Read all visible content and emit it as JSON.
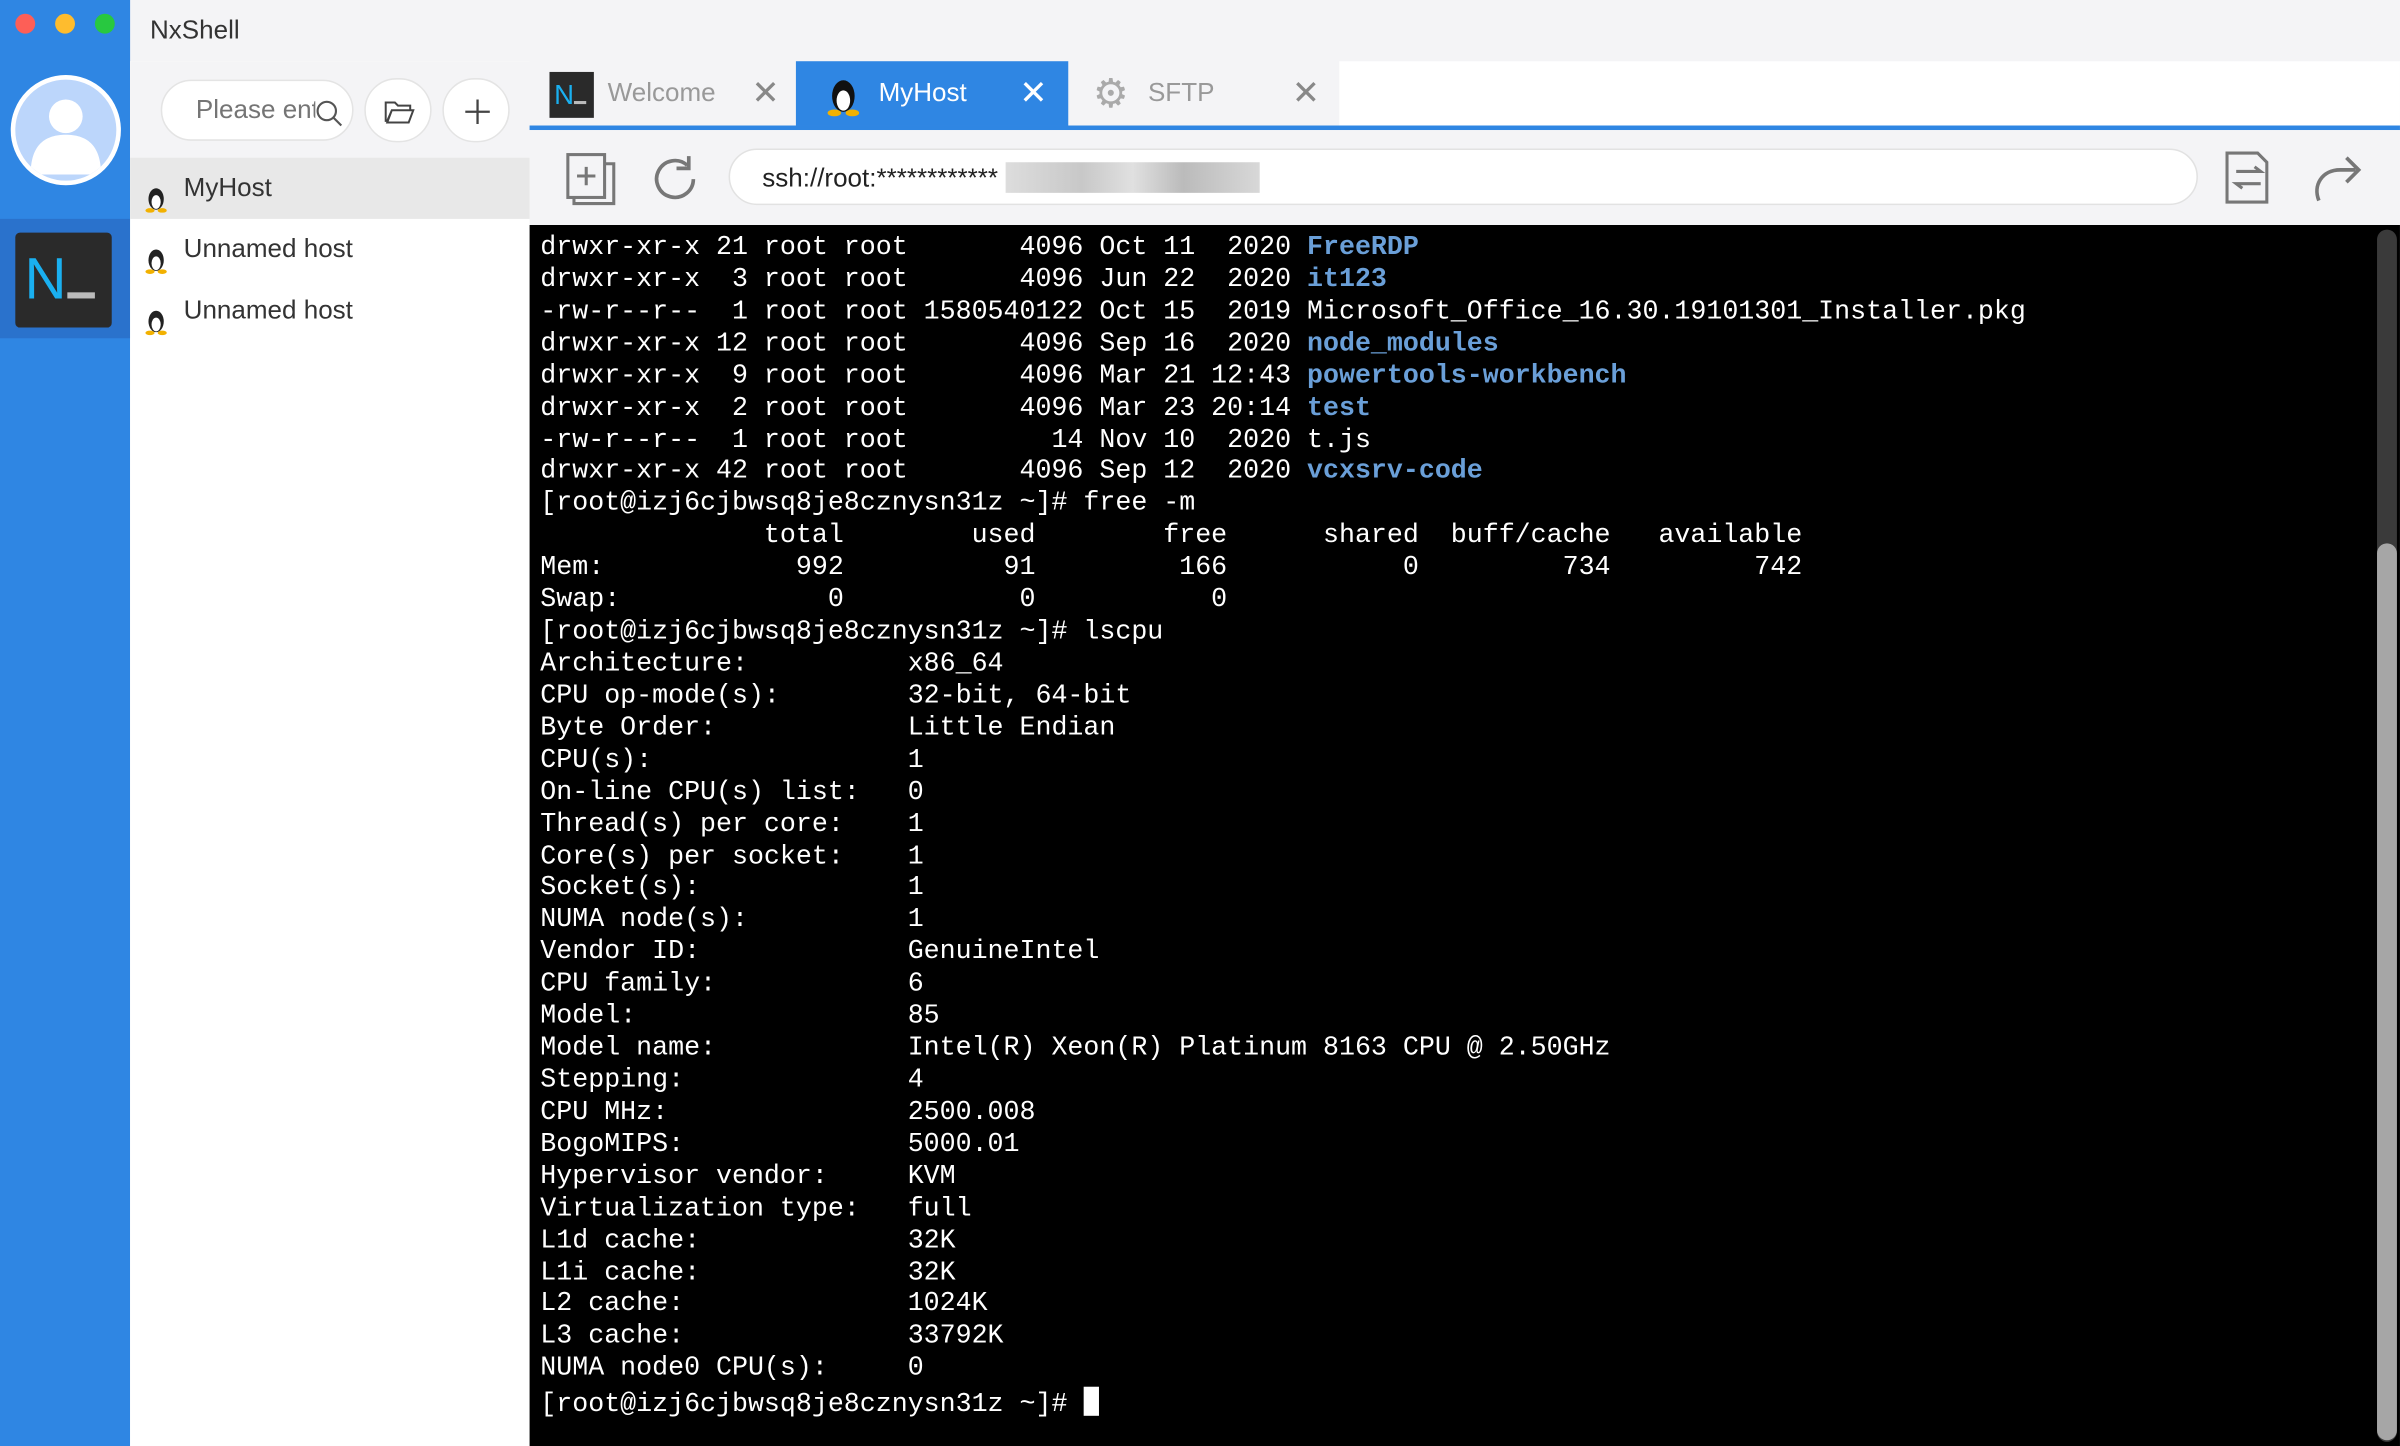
{
  "app": {
    "title": "NxShell"
  },
  "colors": {
    "accent": "#2f86e3",
    "link": "#6a9fd8",
    "terminal_bg": "#000000"
  },
  "sidebar": {
    "search_placeholder": "Please enter",
    "hosts": [
      {
        "label": "MyHost",
        "selected": true
      },
      {
        "label": "Unnamed host"
      },
      {
        "label": "Unnamed host"
      }
    ]
  },
  "tabs": [
    {
      "label": "Welcome",
      "icon": "nxshell-logo-icon"
    },
    {
      "label": "MyHost",
      "icon": "linux-penguin-icon",
      "active": true
    },
    {
      "label": "SFTP",
      "icon": "gear-icon"
    }
  ],
  "toolbar": {
    "url": "ssh://root:************"
  },
  "terminal": {
    "scroll_position_fraction": 1.0,
    "lines": [
      {
        "text": "drwxr-xr-x 21 root root       4096 Oct 11  2020 ",
        "link": "FreeRDP"
      },
      {
        "text": "drwxr-xr-x  3 root root       4096 Jun 22  2020 ",
        "link": "it123"
      },
      {
        "text": "-rw-r--r--  1 root root 1580540122 Oct 15  2019 Microsoft_Office_16.30.19101301_Installer.pkg"
      },
      {
        "text": "drwxr-xr-x 12 root root       4096 Sep 16  2020 ",
        "link": "node_modules"
      },
      {
        "text": "drwxr-xr-x  9 root root       4096 Mar 21 12:43 ",
        "link": "powertools-workbench"
      },
      {
        "text": "drwxr-xr-x  2 root root       4096 Mar 23 20:14 ",
        "link": "test"
      },
      {
        "text": "-rw-r--r--  1 root root         14 Nov 10  2020 t.js"
      },
      {
        "text": "drwxr-xr-x 42 root root       4096 Sep 12  2020 ",
        "link": "vcxsrv-code"
      },
      {
        "text": "[root@izj6cjbwsq8je8cznysn31z ~]# free -m"
      },
      {
        "text": "              total        used        free      shared  buff/cache   available"
      },
      {
        "text": "Mem:            992          91         166           0         734         742"
      },
      {
        "text": "Swap:             0           0           0"
      },
      {
        "text": "[root@izj6cjbwsq8je8cznysn31z ~]# lscpu"
      },
      {
        "text": "Architecture:          x86_64"
      },
      {
        "text": "CPU op-mode(s):        32-bit, 64-bit"
      },
      {
        "text": "Byte Order:            Little Endian"
      },
      {
        "text": "CPU(s):                1"
      },
      {
        "text": "On-line CPU(s) list:   0"
      },
      {
        "text": "Thread(s) per core:    1"
      },
      {
        "text": "Core(s) per socket:    1"
      },
      {
        "text": "Socket(s):             1"
      },
      {
        "text": "NUMA node(s):          1"
      },
      {
        "text": "Vendor ID:             GenuineIntel"
      },
      {
        "text": "CPU family:            6"
      },
      {
        "text": "Model:                 85"
      },
      {
        "text": "Model name:            Intel(R) Xeon(R) Platinum 8163 CPU @ 2.50GHz"
      },
      {
        "text": "Stepping:              4"
      },
      {
        "text": "CPU MHz:               2500.008"
      },
      {
        "text": "BogoMIPS:              5000.01"
      },
      {
        "text": "Hypervisor vendor:     KVM"
      },
      {
        "text": "Virtualization type:   full"
      },
      {
        "text": "L1d cache:             32K"
      },
      {
        "text": "L1i cache:             32K"
      },
      {
        "text": "L2 cache:              1024K"
      },
      {
        "text": "L3 cache:              33792K"
      },
      {
        "text": "NUMA node0 CPU(s):     0"
      },
      {
        "text": "[root@izj6cjbwsq8je8cznysn31z ~]# ",
        "cursor": true
      }
    ]
  }
}
